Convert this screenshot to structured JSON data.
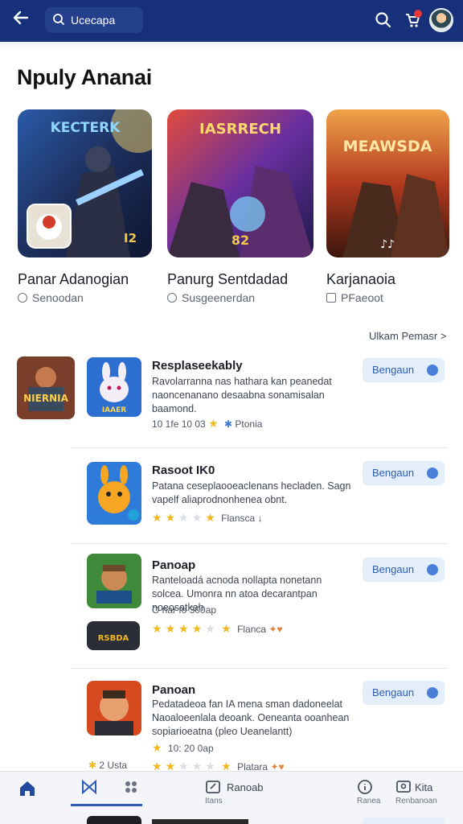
{
  "topbar": {
    "search_text": "Ucecapa",
    "badge_color": "#e53935",
    "bg_color": "#16307a"
  },
  "section": {
    "title": "Npuly Ananai",
    "see_more": "Ulkam Pemasr >"
  },
  "featured": [
    {
      "name": "Panar Adanogian",
      "sub": "Senoodan",
      "art_text": "KECTERK",
      "badge": "I2"
    },
    {
      "name": "Panurg Sentdadad",
      "sub": "Susgeenerdan",
      "art_text": "IASRRECH",
      "badge": "82"
    },
    {
      "name": "Karjanaoia",
      "sub": "PFaeoot",
      "art_text": "MEAWSDA",
      "badge": "♪♪"
    }
  ],
  "list": [
    {
      "name": "Resplaseekably",
      "desc": "Ravolarranna nas hathara kan peanedat naoncenanano desaabna sonamisalan baamond.",
      "meta": "10 1fe 10 03",
      "meta2": "Ptonia",
      "rating": 1,
      "button": "Bengaun",
      "thumb_text": "NIERNIA",
      "thumb_text2": "IAAER"
    },
    {
      "name": "Rasoot IK0",
      "desc": "Patana ceseplaooeaclenans hecladen. Sagn vapelf aliaprodnonhenea obnt.",
      "meta": "Flansca",
      "rating": 2,
      "button": "Bengaun"
    },
    {
      "name": "Panoap",
      "desc": "Ranteloadá acnoda nollapta nonetann solcea. Umonra nn atoa decarantpan noeosatkah",
      "meta": "O nar fo 300ap",
      "meta2": "Flanca",
      "rating": 4,
      "button": "Bengaun",
      "thumb_text": "RSBDA"
    },
    {
      "name": "Panoan",
      "desc": "Pedatadeoa fan IA mena sman dadoneelat Naoaloeenlala deoank. Oeneanta ooanhean sopiarioeatna (pleo Ueanelantt)",
      "meta": "10: 20 0ap",
      "meta2": "Platara",
      "rating": 4,
      "button": "Bengaun"
    }
  ],
  "bottom_nav": {
    "tab3_label": "Ranoab",
    "tab3_sub": "Itans",
    "tab4_sub": "Ranea",
    "tab5_label": "Kita",
    "tab5_sub": "Renbanoan",
    "left_text": "2 Usta"
  }
}
